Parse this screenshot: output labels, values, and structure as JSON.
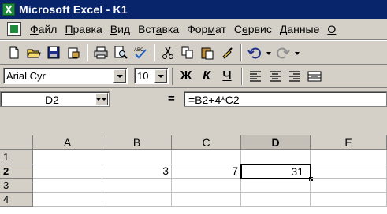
{
  "window": {
    "title": "Microsoft Excel - K1"
  },
  "menu": {
    "items": [
      {
        "pre": "",
        "u": "Ф",
        "post": "айл"
      },
      {
        "pre": "",
        "u": "П",
        "post": "равка"
      },
      {
        "pre": "",
        "u": "В",
        "post": "ид"
      },
      {
        "pre": "Вст",
        "u": "а",
        "post": "вка"
      },
      {
        "pre": "Фор",
        "u": "м",
        "post": "ат"
      },
      {
        "pre": "С",
        "u": "е",
        "post": "рвис"
      },
      {
        "pre": "",
        "u": "Д",
        "post": "анные"
      },
      {
        "pre": "",
        "u": "О",
        "post": ""
      }
    ]
  },
  "toolbar": {
    "buttons": [
      "new-icon",
      "open-icon",
      "save-icon",
      "permission-icon",
      "print-icon",
      "print-preview-icon",
      "spelling-icon",
      "cut-icon",
      "copy-icon",
      "paste-icon",
      "format-painter-icon",
      "undo-icon",
      "redo-icon"
    ]
  },
  "format": {
    "font": "Arial Cyr",
    "size": "10",
    "bold": "Ж",
    "italic": "К",
    "underline": "Ч"
  },
  "formula": {
    "cell_ref": "D2",
    "equals": "=",
    "content": "=B2+4*C2"
  },
  "sheet": {
    "columns": [
      "A",
      "B",
      "C",
      "D",
      "E"
    ],
    "rows": [
      "1",
      "2",
      "3",
      "4"
    ],
    "cells": {
      "B2": "3",
      "C2": "7",
      "D2": "31"
    },
    "active_cell": "D2"
  }
}
